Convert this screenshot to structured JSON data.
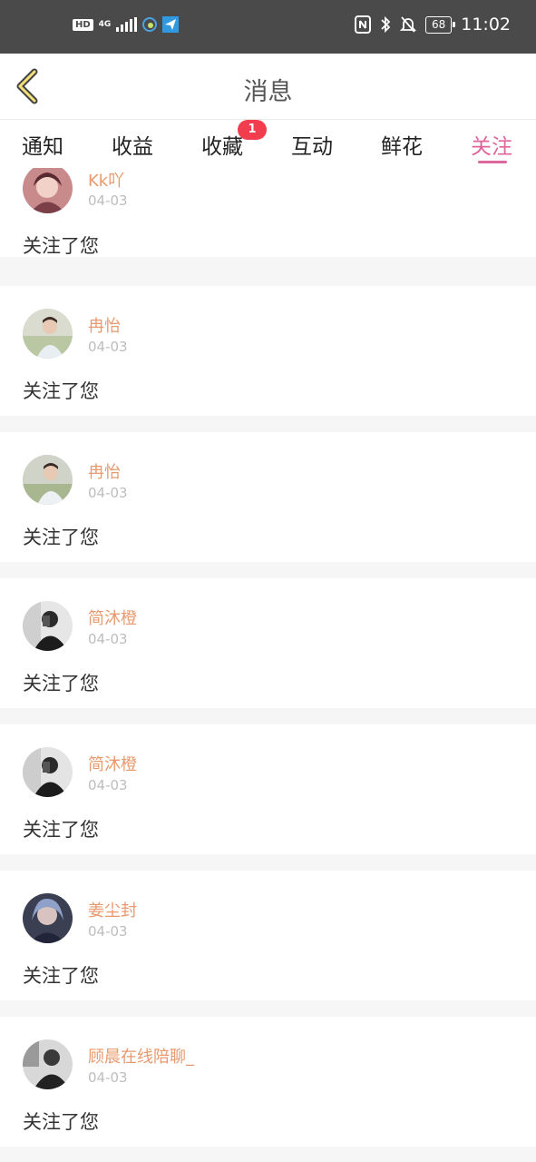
{
  "status_bar": {
    "hd": "HD",
    "network": "4G",
    "battery": "68",
    "time": "11:02"
  },
  "header": {
    "title": "消息",
    "back_icon": "chevron-left-icon"
  },
  "tabs": [
    {
      "label": "通知",
      "active": false
    },
    {
      "label": "收益",
      "active": false
    },
    {
      "label": "收藏",
      "active": false,
      "badge": "1"
    },
    {
      "label": "互动",
      "active": false
    },
    {
      "label": "鲜花",
      "active": false
    },
    {
      "label": "关注",
      "active": true
    }
  ],
  "colors": {
    "accent": "#e0659c",
    "username": "#e89a6e",
    "badge": "#f23d4f"
  },
  "follows": [
    {
      "name": "Kk吖",
      "date": "04-03",
      "message": "关注了您"
    },
    {
      "name": "冉怡",
      "date": "04-03",
      "message": "关注了您"
    },
    {
      "name": "冉怡",
      "date": "04-03",
      "message": "关注了您"
    },
    {
      "name": "简沐橙",
      "date": "04-03",
      "message": "关注了您"
    },
    {
      "name": "简沐橙",
      "date": "04-03",
      "message": "关注了您"
    },
    {
      "name": "姜尘封",
      "date": "04-03",
      "message": "关注了您"
    },
    {
      "name": "顾晨在线陪聊_",
      "date": "04-03",
      "message": "关注了您"
    }
  ]
}
